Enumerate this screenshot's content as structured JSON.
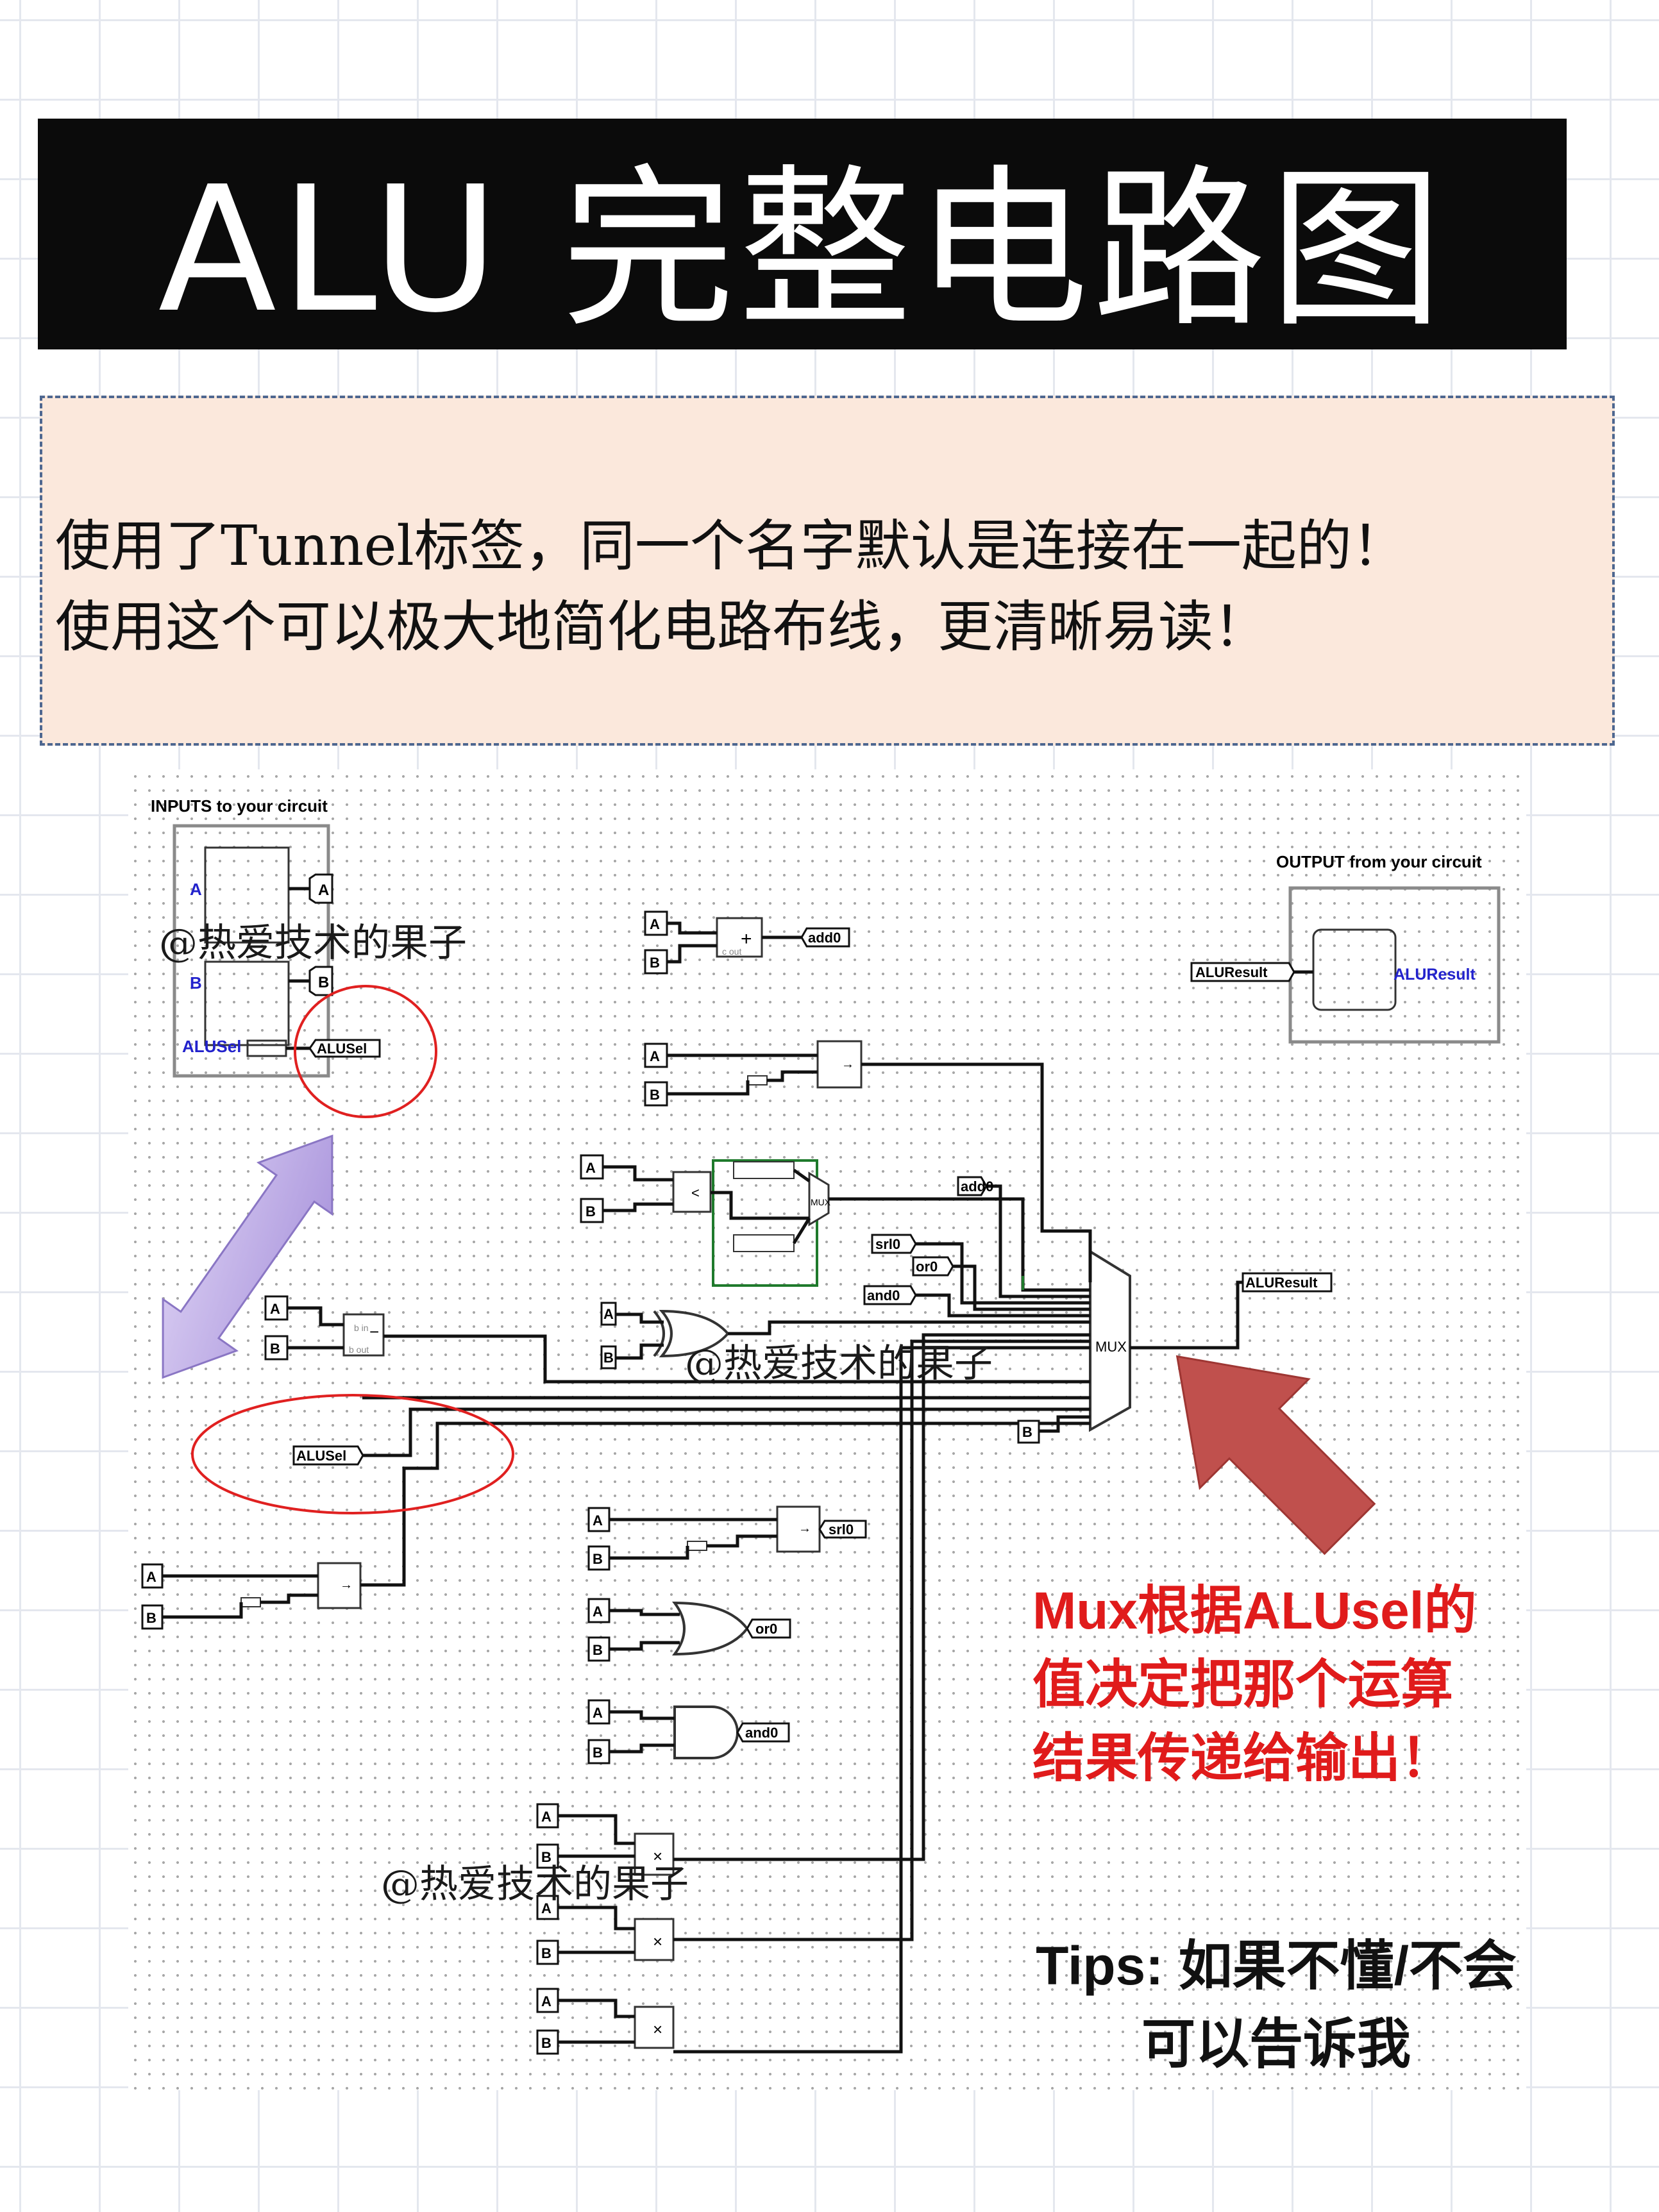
{
  "title": "ALU 完整电路图",
  "note": {
    "line1": "使用了Tunnel标签，同一个名字默认是连接在一起的！",
    "line2": "使用这个可以极大地简化电路布线，更清晰易读！"
  },
  "circuit": {
    "inputs_panel_title": "INPUTS to your circuit",
    "outputs_panel_title": "OUTPUT from your circuit",
    "pin_labels": {
      "a": "A",
      "b": "B",
      "alusel": "ALUSel",
      "aluresult": "ALUResult"
    },
    "tunnels": {
      "a": "A",
      "b": "B",
      "alusel": "ALUSel",
      "aluresult": "ALUResult",
      "add0": "add0",
      "srl0": "srl0",
      "or0": "or0",
      "and0": "and0"
    },
    "component_labels": {
      "mux": "MUX",
      "adder_plus": "+",
      "adder_cout": "c out",
      "sub_bin": "b in",
      "sub_bout": "b out",
      "sub_minus": "−",
      "mul_x": "×",
      "shift_arrow": "→",
      "split": "31-5",
      "cmp": "<"
    }
  },
  "callout": {
    "line1": "Mux根据ALUsel的",
    "line2": "值决定把那个运算",
    "line3": "结果传递给输出！"
  },
  "tips": {
    "line1": "Tips: 如果不懂/不会",
    "line2": "可以告诉我"
  },
  "watermark": "@热爱技术的果子",
  "colors": {
    "title_bg": "#0b0b0b",
    "note_bg": "#fbe8dc",
    "note_border": "#4e6790",
    "callout_text": "#e01b1b",
    "highlight_circle": "#e02020",
    "arrow_red": "#c0504d",
    "arrow_lavender": "#c3b3e6"
  }
}
